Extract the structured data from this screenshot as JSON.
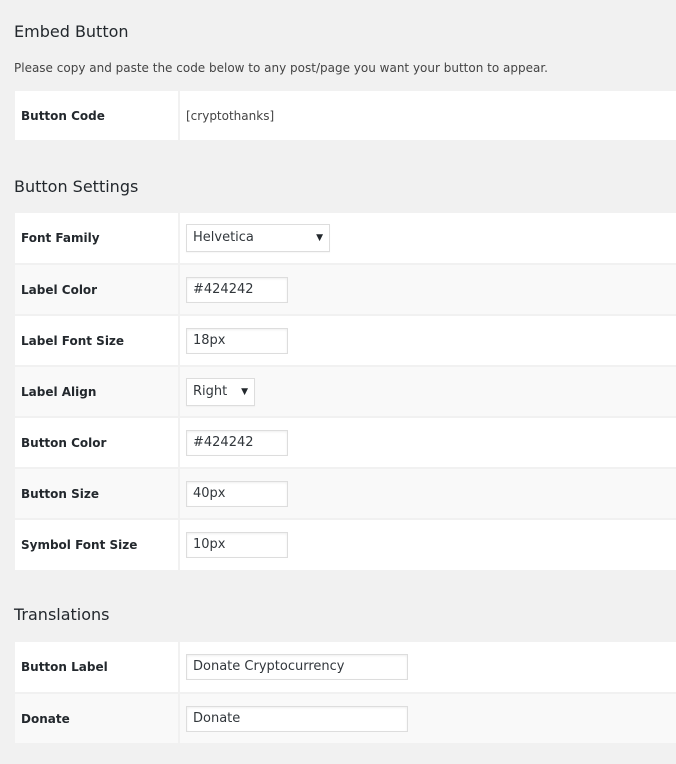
{
  "embed": {
    "title": "Embed Button",
    "description": "Please copy and paste the code below to any post/page you want your button to appear.",
    "code_label": "Button Code",
    "code_value": "[cryptothanks]"
  },
  "settings": {
    "title": "Button Settings",
    "font_family": {
      "label": "Font Family",
      "value": "Helvetica"
    },
    "label_color": {
      "label": "Label Color",
      "value": "#424242"
    },
    "label_font_size": {
      "label": "Label Font Size",
      "value": "18px"
    },
    "label_align": {
      "label": "Label Align",
      "value": "Right"
    },
    "button_color": {
      "label": "Button Color",
      "value": "#424242"
    },
    "button_size": {
      "label": "Button Size",
      "value": "40px"
    },
    "symbol_font_size": {
      "label": "Symbol Font Size",
      "value": "10px"
    }
  },
  "translations": {
    "title": "Translations",
    "button_label": {
      "label": "Button Label",
      "value": "Donate Cryptocurrency"
    },
    "donate": {
      "label": "Donate",
      "value": "Donate"
    }
  },
  "icons": {
    "dropdown": "chevron-down-icon"
  }
}
